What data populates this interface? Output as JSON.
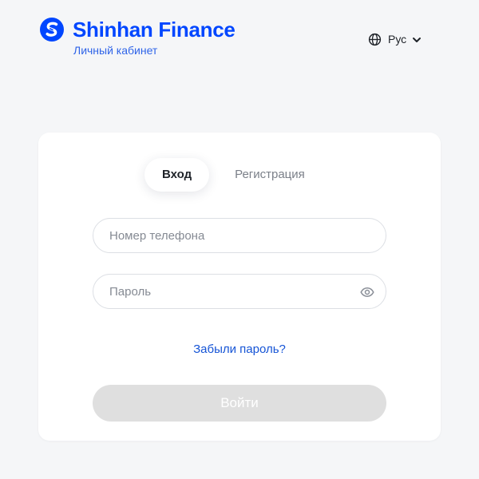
{
  "header": {
    "brand": "Shinhan Finance",
    "subtitle": "Личный кабинет",
    "language": {
      "label": "Рус",
      "icon": "globe-icon",
      "dropdown_icon": "chevron-down-icon"
    }
  },
  "login_card": {
    "tabs": [
      {
        "label": "Вход",
        "active": true
      },
      {
        "label": "Регистрация",
        "active": false
      }
    ],
    "phone_field": {
      "placeholder": "Номер телефона",
      "value": ""
    },
    "password_field": {
      "placeholder": "Пароль",
      "value": "",
      "toggle_icon": "eye-icon"
    },
    "forgot_link": "Забыли пароль?",
    "submit_label": "Войти",
    "submit_disabled": true
  },
  "colors": {
    "brand": "#0046ff",
    "link": "#1554d6",
    "page_background": "#f5f6f8",
    "button_disabled": "#dfdfdf"
  }
}
